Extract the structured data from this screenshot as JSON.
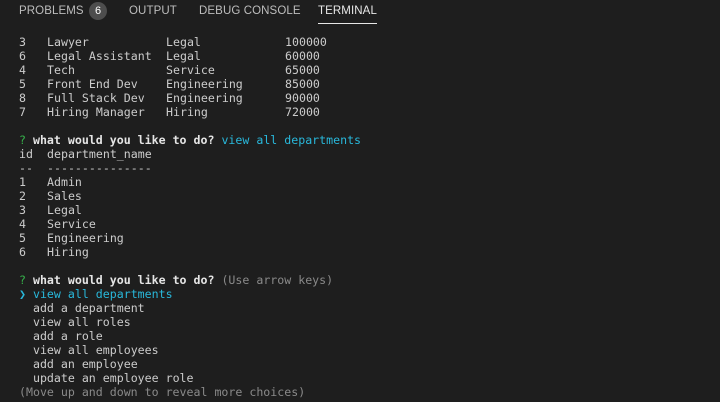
{
  "tabs": {
    "problems": "PROBLEMS",
    "problems_count": "6",
    "output": "OUTPUT",
    "debug_console": "DEBUG CONSOLE",
    "terminal": "TERMINAL"
  },
  "roles_rows": [
    [
      "3",
      "Lawyer",
      "Legal",
      "100000"
    ],
    [
      "6",
      "Legal Assistant",
      "Legal",
      "60000"
    ],
    [
      "4",
      "Tech",
      "Service",
      "65000"
    ],
    [
      "5",
      "Front End Dev",
      "Engineering",
      "85000"
    ],
    [
      "8",
      "Full Stack Dev",
      "Engineering",
      "90000"
    ],
    [
      "7",
      "Hiring Manager",
      "Hiring",
      "72000"
    ]
  ],
  "prompt1": {
    "mark": "?",
    "question": "what would you like to do?",
    "answer": "view all departments"
  },
  "dept_table": {
    "headers": [
      "id",
      "department_name"
    ],
    "separators": [
      "--",
      "---------------"
    ],
    "rows": [
      [
        "1",
        "Admin"
      ],
      [
        "2",
        "Sales"
      ],
      [
        "3",
        "Legal"
      ],
      [
        "4",
        "Service"
      ],
      [
        "5",
        "Engineering"
      ],
      [
        "6",
        "Hiring"
      ]
    ]
  },
  "prompt2": {
    "mark": "?",
    "question": "what would you like to do?",
    "hint": "(Use arrow keys)",
    "pointer": "❯",
    "selected": "view all departments",
    "choices": [
      "add a department",
      "view all roles",
      "add a role",
      "view all employees",
      "add an employee",
      "update an employee role"
    ],
    "footer": "(Move up and down to reveal more choices)"
  },
  "colors": {
    "background": "#1e1e1e",
    "text": "#cccccc",
    "prompt_mark": "#35b14a",
    "answer": "#29b8db",
    "hint": "#8a8a8a"
  }
}
